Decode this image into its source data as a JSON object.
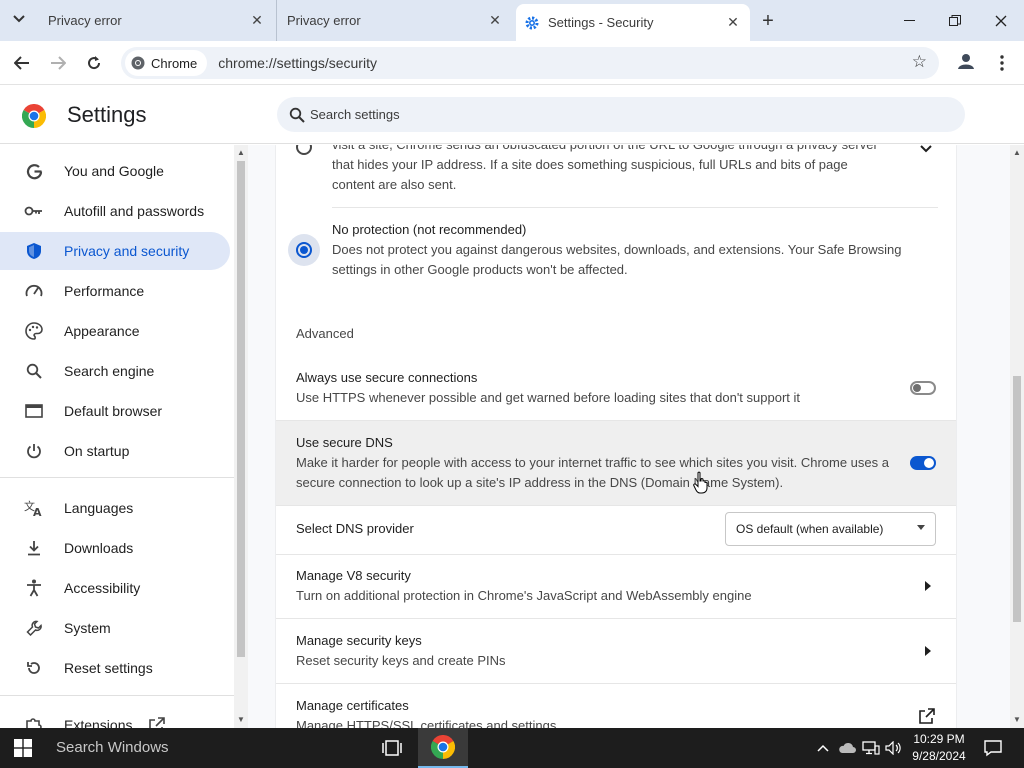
{
  "tabs": [
    {
      "title": "Privacy error"
    },
    {
      "title": "Privacy error"
    },
    {
      "title": "Settings - Security"
    }
  ],
  "toolbar": {
    "chip_label": "Chrome",
    "url": "chrome://settings/security"
  },
  "settings": {
    "title": "Settings",
    "search_placeholder": "Search settings"
  },
  "sidebar": {
    "items": [
      {
        "label": "You and Google"
      },
      {
        "label": "Autofill and passwords"
      },
      {
        "label": "Privacy and security"
      },
      {
        "label": "Performance"
      },
      {
        "label": "Appearance"
      },
      {
        "label": "Search engine"
      },
      {
        "label": "Default browser"
      },
      {
        "label": "On startup"
      },
      {
        "label": "Languages"
      },
      {
        "label": "Downloads"
      },
      {
        "label": "Accessibility"
      },
      {
        "label": "System"
      },
      {
        "label": "Reset settings"
      },
      {
        "label": "Extensions"
      }
    ]
  },
  "main": {
    "standard_desc_1": "visit a site, Chrome sends an obfuscated portion of the URL to Google through a privacy server",
    "standard_desc_2": "that hides your IP address. If a site does something suspicious, full URLs and bits of page",
    "standard_desc_3": "content are also sent.",
    "no_protection_title": "No protection (not recommended)",
    "no_protection_desc_1": "Does not protect you against dangerous websites, downloads, and extensions. Your Safe Browsing",
    "no_protection_desc_2": "settings in other Google products won't be affected.",
    "advanced_heading": "Advanced",
    "https_title": "Always use secure connections",
    "https_desc": "Use HTTPS whenever possible and get warned before loading sites that don't support it",
    "dns_title": "Use secure DNS",
    "dns_desc_1": "Make it harder for people with access to your internet traffic to see which sites you visit. Chrome uses a",
    "dns_desc_2": "secure connection to look up a site's IP address in the DNS (Domain Name System).",
    "dns_provider_label": "Select DNS provider",
    "dns_provider_value": "OS default (when available)",
    "v8_title": "Manage V8 security",
    "v8_desc": "Turn on additional protection in Chrome's JavaScript and WebAssembly engine",
    "keys_title": "Manage security keys",
    "keys_desc": "Reset security keys and create PINs",
    "certs_title": "Manage certificates",
    "certs_desc": "Manage HTTPS/SSL certificates and settings"
  },
  "state": {
    "https_toggle": false,
    "dns_toggle": true,
    "no_protection_selected": true
  },
  "taskbar": {
    "search_placeholder": "Search Windows",
    "time": "10:29 PM",
    "date": "9/28/2024"
  },
  "colors": {
    "accent": "#0b57d0",
    "tabstrip": "#dfe7f3",
    "active_nav": "#dfe7f7"
  }
}
